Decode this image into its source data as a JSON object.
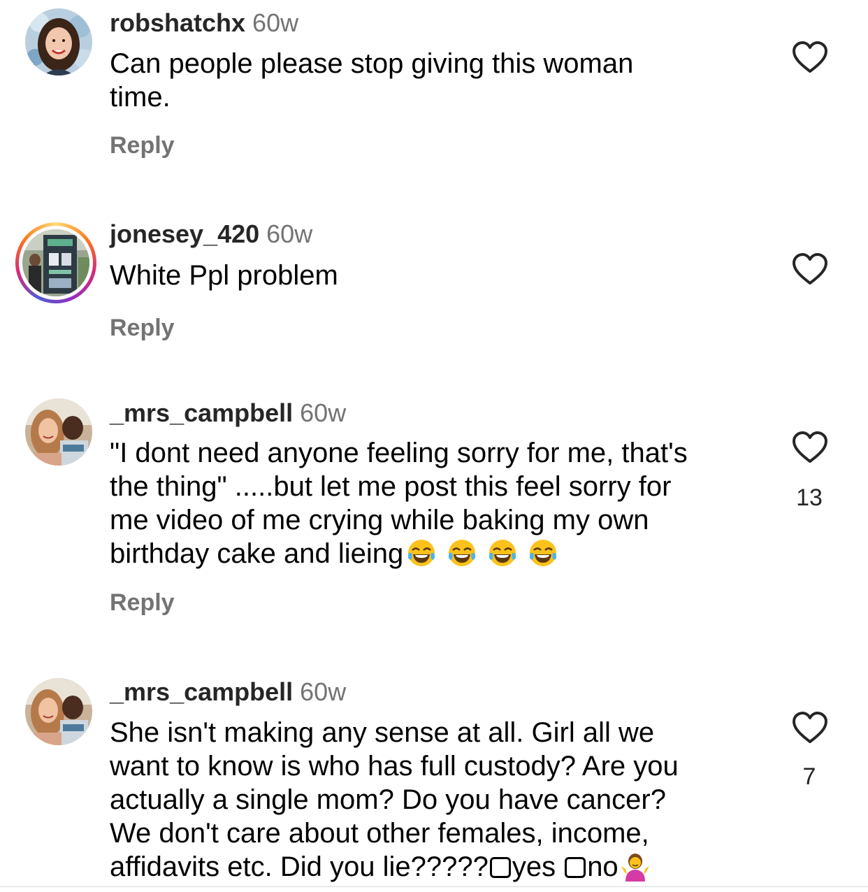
{
  "comments": [
    {
      "username": "robshatchx",
      "time": "60w",
      "text": "Can people please stop giving this woman\ntime.",
      "reply": "Reply",
      "likes": ""
    },
    {
      "username": "jonesey_420",
      "time": "60w",
      "text": "White Ppl problem",
      "reply": "Reply",
      "likes": ""
    },
    {
      "username": "_mrs_campbell",
      "time": "60w",
      "text_lines": [
        "\"I dont need anyone feeling sorry for me, that's",
        "the thing\" .....but let me post this feel sorry for",
        "me video of me crying while baking my own",
        "birthday cake and lieing"
      ],
      "emoji": [
        "face-with-tears-of-joy",
        "face-with-tears-of-joy",
        "face-with-tears-of-joy",
        "face-with-tears-of-joy"
      ],
      "reply": "Reply",
      "likes": "13"
    },
    {
      "username": "_mrs_campbell",
      "time": "60w",
      "text_lines": [
        "She isn't making any sense at all. Girl all we",
        "want to know is who has full custody? Are you",
        "actually a single mom? Do you have cancer?",
        "We don't care about other females, income,"
      ],
      "last_line_prefix": "affidavits etc. Did you lie?????",
      "option_yes": "yes ",
      "option_no": "no",
      "trailing_emoji": "person-shrugging",
      "likes": "7"
    }
  ],
  "colors": {
    "username": "#262626",
    "meta": "#737373",
    "text": "#000000",
    "story_ring": [
      "#feda75",
      "#fa7e1e",
      "#d62976",
      "#962fbf",
      "#4f5bd5"
    ]
  }
}
